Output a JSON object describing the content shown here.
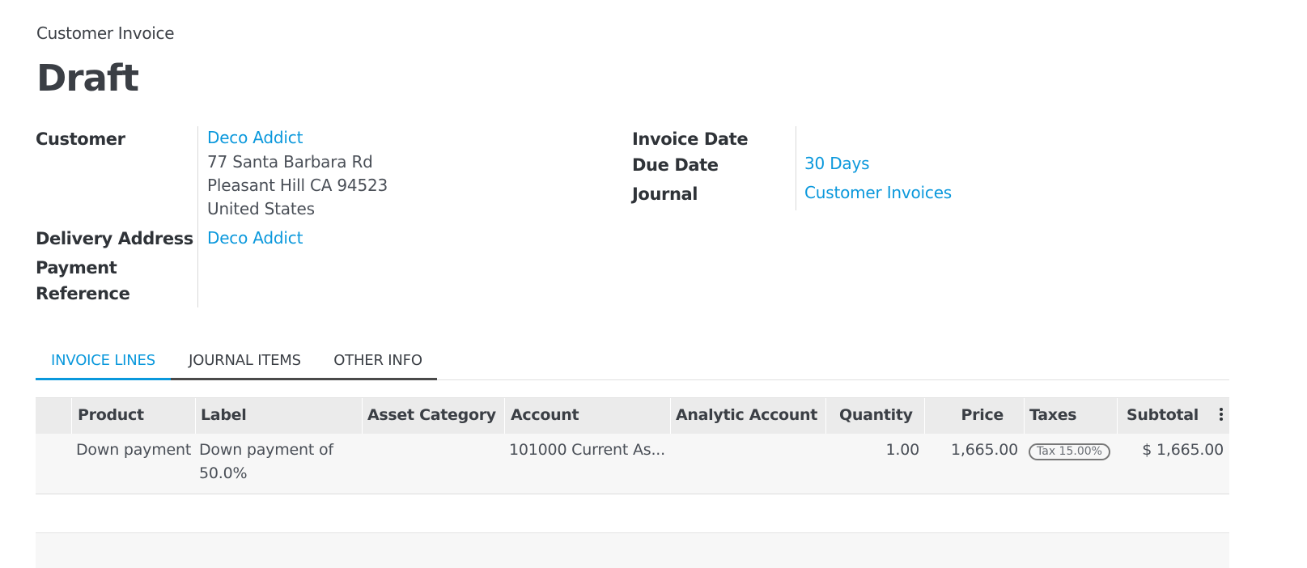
{
  "header": {
    "subtitle": "Customer Invoice",
    "title": "Draft"
  },
  "form": {
    "customer_label": "Customer",
    "customer_name": "Deco Addict",
    "customer_address": [
      "77 Santa Barbara Rd",
      "Pleasant Hill CA 94523",
      "United States"
    ],
    "delivery_label": "Delivery Address",
    "delivery_value": "Deco Addict",
    "payment_ref_label_1": "Payment",
    "payment_ref_label_2": "Reference",
    "invoice_date_label": "Invoice Date",
    "due_date_label": "Due Date",
    "due_date_value": "30 Days",
    "journal_label": "Journal",
    "journal_value": "Customer Invoices"
  },
  "tabs": [
    {
      "label": "Invoice Lines",
      "active": true
    },
    {
      "label": "Journal Items",
      "active": false
    },
    {
      "label": "Other Info",
      "active": false
    }
  ],
  "table": {
    "columns": [
      "Product",
      "Label",
      "Asset Category",
      "Account",
      "Analytic Account",
      "Quantity",
      "Price",
      "Taxes",
      "Subtotal"
    ],
    "rows": [
      {
        "product": "Down payment",
        "label_line1": "Down payment of",
        "label_line2": "50.0%",
        "asset_category": "",
        "account": "101000 Current As...",
        "analytic_account": "",
        "quantity": "1.00",
        "price": "1,665.00",
        "taxes": "Tax 15.00%",
        "subtotal": "$ 1,665.00"
      }
    ]
  },
  "colors": {
    "link": "#0a98dc",
    "text": "#444b5a",
    "header_bg": "#ebebeb"
  }
}
